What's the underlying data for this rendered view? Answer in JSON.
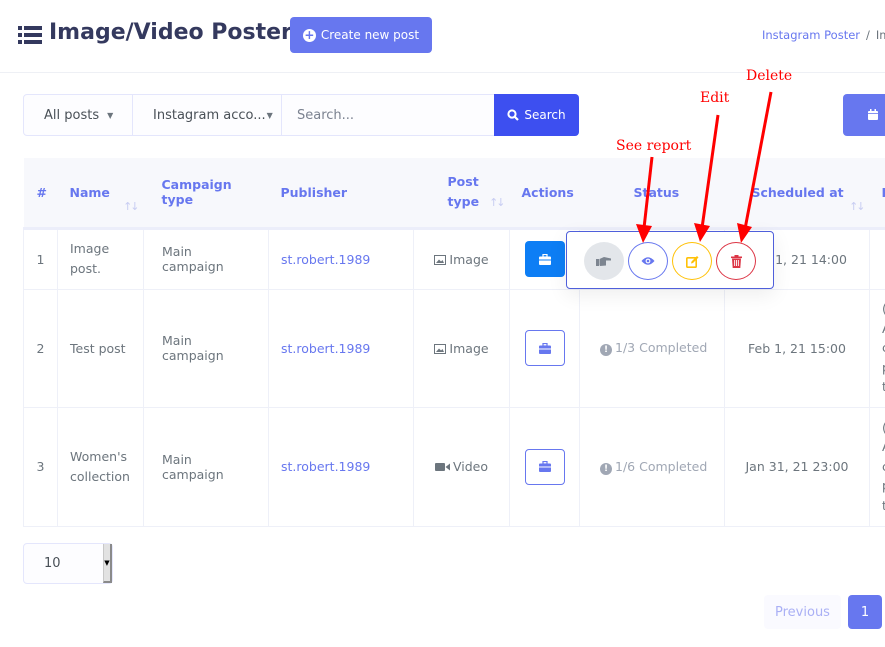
{
  "header": {
    "title": "Image/Video Poster",
    "create_button": "Create new post",
    "breadcrumb": [
      {
        "label": "Instagram Poster",
        "link": true
      },
      {
        "label": "Im",
        "link": false
      }
    ]
  },
  "filters": {
    "post_filter": "All posts",
    "account_filter": "Instagram acco...",
    "search_placeholder": "Search...",
    "search_value": "",
    "search_button": "Search"
  },
  "table": {
    "columns": [
      "#",
      "Name",
      "Campaign type",
      "Publisher",
      "Post\ntype",
      "Actions",
      "Status",
      "Scheduled at",
      "E"
    ],
    "rows": [
      {
        "num": "1",
        "name": "Image post.",
        "campaign": "Main campaign",
        "publisher": "st.robert.1989",
        "post_type": "Image",
        "post_type_icon": "image-icon",
        "action_style": "solid",
        "status": "",
        "scheduled": "1, 21 14:00",
        "extra": [
          ""
        ]
      },
      {
        "num": "2",
        "name": "Test post",
        "campaign": "Main campaign",
        "publisher": "st.robert.1989",
        "post_type": "Image",
        "post_type_icon": "image-icon",
        "action_style": "outline",
        "status": "1/3 Completed",
        "scheduled": "Feb 1, 21 15:00",
        "extra": [
          "(",
          "A",
          "c",
          "p",
          "t"
        ]
      },
      {
        "num": "3",
        "name": "Women's collection",
        "campaign": "Main campaign",
        "publisher": "st.robert.1989",
        "post_type": "Video",
        "post_type_icon": "video-icon",
        "action_style": "outline",
        "status": "1/6 Completed",
        "scheduled": "Jan 31, 21 23:00",
        "extra": [
          "(",
          "A",
          "c",
          "p",
          "t"
        ]
      }
    ]
  },
  "action_popover": {
    "buttons": [
      "hand-pointer",
      "see-report",
      "edit",
      "delete"
    ]
  },
  "annotations": {
    "see_report": "See report",
    "edit": "Edit",
    "delete": "Delete"
  },
  "pagination": {
    "page_length": "10",
    "previous": "Previous",
    "current_page": "1"
  },
  "colors": {
    "primary": "#6777ef",
    "search_button": "#3d4ff0",
    "action_solid": "#0d7ef5",
    "edit": "#ffc107",
    "delete": "#dc3545",
    "annotation": "#ff0000"
  }
}
